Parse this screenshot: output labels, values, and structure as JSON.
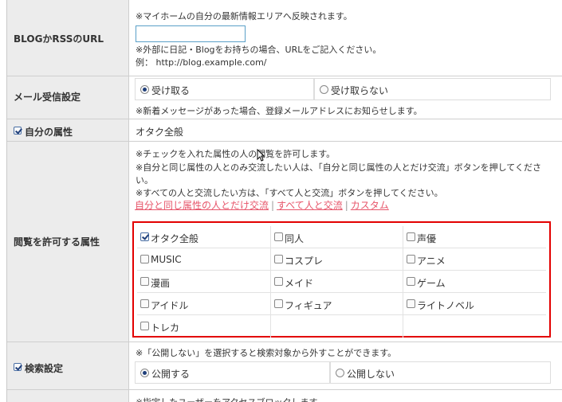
{
  "blog": {
    "label": "BLOGかRSSのURL",
    "note_top": "※マイホームの自分の最新情報エリアへ反映されます。",
    "input_value": "",
    "note_bottom1": "※外部に日記・Blogをお持ちの場合、URLをご記入ください。",
    "note_bottom2": "例：  http://blog.example.com/"
  },
  "mail": {
    "label": "メール受信設定",
    "option_receive": "受け取る",
    "option_decline": "受け取らない",
    "selected": "受け取る",
    "note": "※新着メッセージがあった場合、登録メールアドレスにお知らせします。"
  },
  "self_attr": {
    "label": "自分の属性",
    "checked": true,
    "value": "オタク全般"
  },
  "view_attr": {
    "label": "閲覧を許可する属性",
    "note1": "※チェックを入れた属性の人の閲覧を許可します。",
    "note2a": "※自分と同じ属性の人とのみ交流したい人は、「自分と同じ属性の人とだけ交流」ボタンを押してくださ",
    "note2b": "い。",
    "note3": "※すべての人と交流したい方は、「すべて人と交流」ボタンを押してください。",
    "link_same": "自分と同じ属性の人とだけ交流",
    "link_all": "すべて人と交流",
    "link_custom": "カスタム",
    "separator": "|",
    "options": [
      {
        "label": "オタク全般",
        "checked": true
      },
      {
        "label": "同人",
        "checked": false
      },
      {
        "label": "声優",
        "checked": false
      },
      {
        "label": "MUSIC",
        "checked": false
      },
      {
        "label": "コスプレ",
        "checked": false
      },
      {
        "label": "アニメ",
        "checked": false
      },
      {
        "label": "漫画",
        "checked": false
      },
      {
        "label": "メイド",
        "checked": false
      },
      {
        "label": "ゲーム",
        "checked": false
      },
      {
        "label": "アイドル",
        "checked": false
      },
      {
        "label": "フィギュア",
        "checked": false
      },
      {
        "label": "ライトノベル",
        "checked": false
      },
      {
        "label": "トレカ",
        "checked": false
      }
    ],
    "highlight_color": "#e30000",
    "link_color": "#e7556a"
  },
  "search": {
    "label": "検索設定",
    "checked": true,
    "note": "※「公開しない」を選択すると検索対象から外すことができます。",
    "option_public": "公開する",
    "option_private": "公開しない",
    "selected": "公開する"
  },
  "block": {
    "note_partial": "※指定したユーザーをアクセスブロックします。"
  }
}
